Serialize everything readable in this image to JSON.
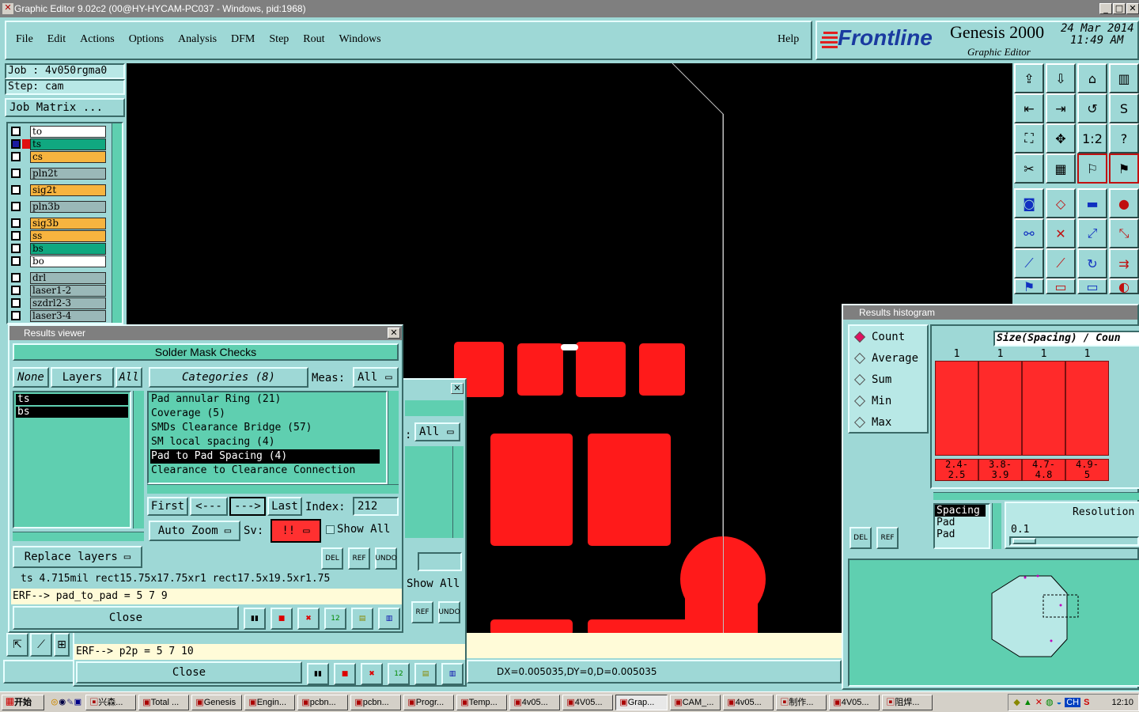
{
  "window": {
    "title": "Graphic Editor 9.02c2 (00@HY-HYCAM-PC037 - Windows, pid:1968)",
    "min": "_",
    "max": "□",
    "close": "✕"
  },
  "menu": [
    "File",
    "Edit",
    "Actions",
    "Options",
    "Analysis",
    "DFM",
    "Step",
    "Rout",
    "Windows"
  ],
  "help": "Help",
  "brand": {
    "logo": "Frontline",
    "product": "Genesis 2000",
    "subtitle": "Graphic Editor",
    "date": "24 Mar 2014",
    "time": "11:49 AM"
  },
  "job": {
    "job": "Job  : 4v050rgma0",
    "step": "Step: cam",
    "matrix": "Job Matrix ..."
  },
  "layers": [
    {
      "name": "to",
      "color": "white"
    },
    {
      "name": "ts",
      "color": "green"
    },
    {
      "name": "cs",
      "color": "orange"
    },
    {
      "name": "pln2t",
      "color": "gray"
    },
    {
      "name": "sig2t",
      "color": "orange"
    },
    {
      "name": "pln3b",
      "color": "gray"
    },
    {
      "name": "sig3b",
      "color": "orange"
    },
    {
      "name": "ss",
      "color": "orange"
    },
    {
      "name": "bs",
      "color": "green"
    },
    {
      "name": "bo",
      "color": "white"
    },
    {
      "name": "drl",
      "color": "gray"
    },
    {
      "name": "laser1-2",
      "color": "gray"
    },
    {
      "name": "szdrl2-3",
      "color": "gray"
    },
    {
      "name": "laser3-4",
      "color": "gray"
    }
  ],
  "results": {
    "title": "Results viewer",
    "header": "Solder Mask Checks",
    "none": "None",
    "layers_label": "Layers",
    "all": "All",
    "categories_label": "Categories (8)",
    "meas_label": "Meas:",
    "meas_value": "All",
    "layer_list": [
      "ts",
      "bs"
    ],
    "categories": [
      "Pad annular Ring (21)",
      "Coverage (5)",
      "SMDs Clearance Bridge (57)",
      "SM local spacing (4)",
      "Pad to Pad Spacing (4)",
      "Clearance to Clearance Connection"
    ],
    "first": "First",
    "prev": "<---",
    "next": "--->",
    "last": "Last",
    "index_label": "Index:",
    "index": "212",
    "auto_zoom": "Auto Zoom",
    "sv": "Sv:",
    "sv_value": "!!",
    "show_all": "Show All",
    "replace": "Replace layers",
    "measure": "ts 4.715mil  rect15.75x17.75xr1  rect17.5x19.5xr1.75",
    "erf": "ERF--> pad_to_pad = 5 7 9",
    "close": "Close",
    "del": "DEL",
    "ref": "REF",
    "undo": "UNDO"
  },
  "back_window": {
    "meas": "All",
    "show_all": "Show All",
    "erf": "ERF--> p2p = 5 7 10",
    "close": "Close",
    "ref": "REF",
    "undo": "UNDO"
  },
  "histogram": {
    "title": "Results histogram",
    "modes": [
      "Count",
      "Average",
      "Sum",
      "Min",
      "Max"
    ],
    "selected": "Count",
    "chart_title": "Size(Spacing) / Coun",
    "counts": [
      "1",
      "1",
      "1",
      "1"
    ],
    "bins": [
      [
        "2.4-",
        "2.5"
      ],
      [
        "3.8-",
        "3.9"
      ],
      [
        "4.7-",
        "4.8"
      ],
      [
        "4.9-",
        "5"
      ]
    ],
    "attr_list": [
      "Spacing",
      "Pad",
      "Pad"
    ],
    "resolution_label": "Resolution",
    "resolution": "0.1",
    "del": "DEL",
    "ref": "REF"
  },
  "status": {
    "dx": "DX=0.005035,DY=0,D=0.005035"
  },
  "taskbar": {
    "start": "开始",
    "items": [
      "兴森...",
      "Total ...",
      "Genesis",
      "Engin...",
      "pcbn...",
      "pcbn...",
      "Progr...",
      "Temp...",
      "4v05...",
      "4V05...",
      "Grap...",
      "CAM_...",
      "4v05...",
      "制作...",
      "4V05...",
      "阻焊..."
    ],
    "lang": "CH",
    "clock": "12:10"
  },
  "colors": {
    "accent": "#5fcfb0",
    "pad": "#ff1a1a",
    "bg": "#9ed8d6"
  }
}
